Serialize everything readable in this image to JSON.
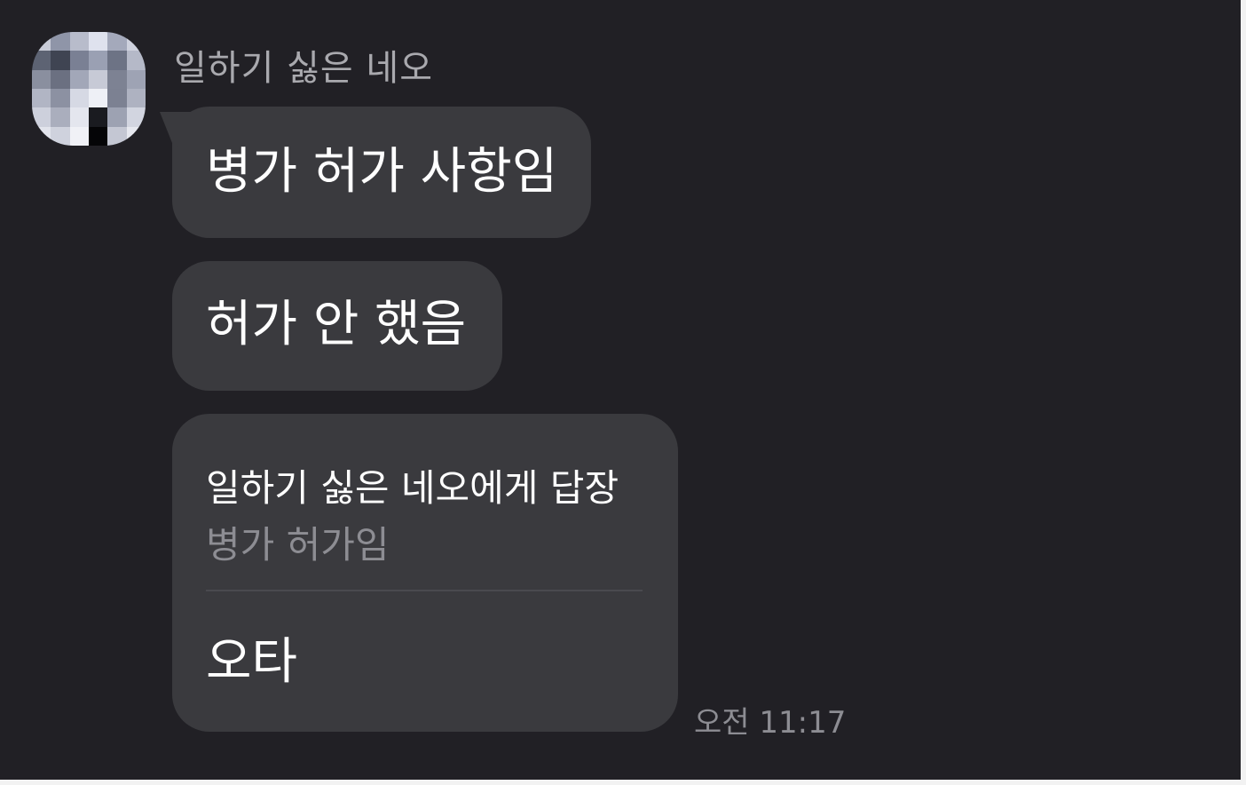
{
  "sender": {
    "name": "일하기 싫은 네오"
  },
  "messages": [
    {
      "text": "병가 허가 사항임"
    },
    {
      "text": "허가 안 했음"
    },
    {
      "reply_to_label": "일하기 싫은 네오에게 답장",
      "quoted_text": "병가 허가임",
      "text": "오타"
    }
  ],
  "timestamp": "오전 11:17",
  "colors": {
    "background": "#212025",
    "bubble": "#3a3a3e",
    "text_primary": "#ffffff",
    "text_secondary": "#8d8d93"
  }
}
